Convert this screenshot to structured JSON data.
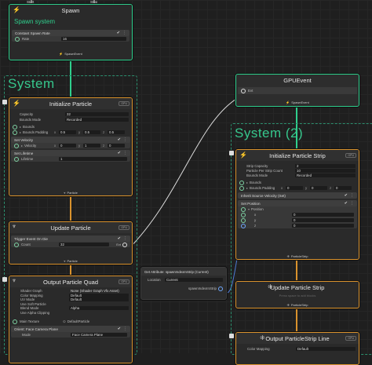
{
  "flow": {
    "start": "Start",
    "stop": "Stop"
  },
  "spawn": {
    "title": "Spawn",
    "name": "Spawn system",
    "block": "Constant Spawn Rate",
    "rate_label": "Rate",
    "rate_value": "16",
    "footer": "SpawnEvent"
  },
  "system1": {
    "title": "System"
  },
  "system2": {
    "title": "System (2)"
  },
  "init": {
    "title": "Initialize Particle",
    "badge": "GPU",
    "capacity_label": "Capacity",
    "capacity_value": "32",
    "bounds_mode_label": "Bounds Mode",
    "bounds_mode_value": "Recorded",
    "bounds_label": "Bounds",
    "bounds_padding_label": "Bounds Padding",
    "bounds_padding": [
      "0.5",
      "0.5",
      "0.5"
    ],
    "set_velocity": "Set Velocity",
    "velocity_label": "Velocity",
    "velocity": [
      "0",
      "1",
      "0"
    ],
    "set_lifetime": "Set Lifetime",
    "lifetime_label": "Lifetime",
    "lifetime_value": "1",
    "footer": "Particle"
  },
  "update": {
    "title": "Update Particle",
    "badge": "GPU",
    "block": "Trigger Event On Die",
    "count_label": "Count",
    "count_value": "32",
    "evt_label": "Evt",
    "footer": "Particle"
  },
  "output": {
    "title": "Output Particle Quad",
    "badge": "GPU",
    "shader_graph_label": "Shader Graph",
    "shader_graph_value": "None (Shader Graph Vfx Asset)",
    "color_mapping_label": "Color Mapping",
    "color_mapping_value": "Default",
    "uv_mode_label": "UV Mode",
    "uv_mode_value": "Default",
    "soft_particle_label": "Use Soft Particle",
    "blend_mode_label": "Blend Mode",
    "blend_mode_value": "Alpha",
    "alpha_clip_label": "Use Alpha Clipping",
    "main_texture_label": "Main Texture",
    "main_texture_value": "DefaultParticle",
    "orient_block": "Orient: Face Camera Plane",
    "mode_label": "Mode",
    "mode_value": "Face Camera Plane"
  },
  "gpuevent": {
    "title": "GPUEvent",
    "evt_label": "Evt",
    "footer": "SpawnEvent"
  },
  "attrnode": {
    "title": "Get Attribute: spawnIndexInStrip (Current)",
    "location_label": "Location",
    "location_value": "Current",
    "output_label": "spawnIndexInStrip"
  },
  "init_strip": {
    "title": "Initialize Particle Strip",
    "badge": "GPU",
    "strip_capacity_label": "Strip Capacity",
    "strip_capacity_value": "2",
    "ppsc_label": "Particle Per Strip Count",
    "ppsc_value": "10",
    "bounds_mode_label": "Bounds Mode",
    "bounds_mode_value": "Recorded",
    "bounds_label": "Bounds",
    "bounds_padding_label": "Bounds Padding",
    "bounds_padding": [
      "0",
      "0",
      "0"
    ],
    "inherit_block": "Inherit Source Velocity (Set)",
    "set_position": "Set Position",
    "position_label": "Position",
    "pos_x": "0",
    "pos_y": "0",
    "pos_z": "0",
    "footer": "ParticleStrip"
  },
  "update_strip": {
    "title": "Update Particle Strip",
    "hint": "Press space to add blocks",
    "footer": "ParticleStrip"
  },
  "output_strip": {
    "title": "Output ParticleStrip Line",
    "badge": "GPU",
    "color_mapping_label": "Color Mapping",
    "color_mapping_value": "Default"
  },
  "colors": {
    "spawn": "#2fcf8d",
    "particle": "#d9922d",
    "system": "#36c68c",
    "attribute": "#4d7bd6"
  }
}
